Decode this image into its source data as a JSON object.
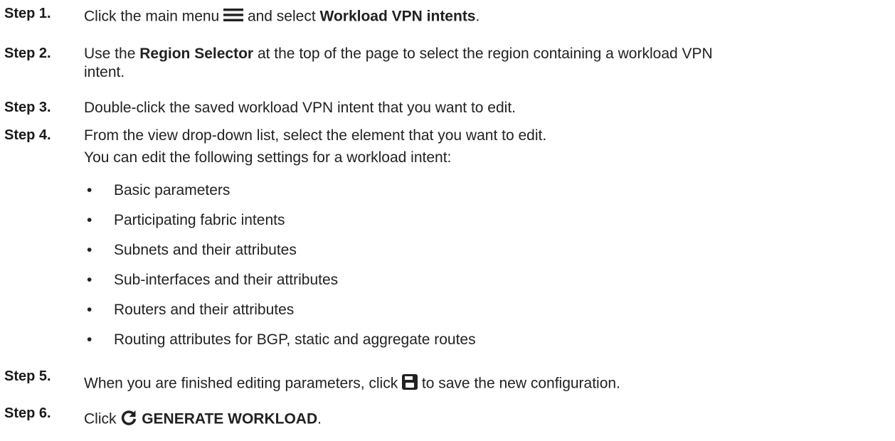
{
  "steps": [
    {
      "label": "Step 1.",
      "pre": "Click the main menu",
      "mid": "and select",
      "bold": "Workload VPN intents",
      "post": ".",
      "icon": "menu-icon"
    },
    {
      "label": "Step 2.",
      "pre": "Use the",
      "bold": "Region Selector",
      "post": "at the top of the page to select the region containing a workload VPN",
      "cont": "intent."
    },
    {
      "label": "Step 3.",
      "text": "Double-click the saved workload VPN intent that you want to edit."
    },
    {
      "label": "Step 4.",
      "text": "From the view drop-down list, select the element that you want to edit.",
      "subtext": "You can edit the following settings for a workload intent:",
      "bullet_char": "•",
      "bullets": [
        "Basic parameters",
        "Participating fabric intents",
        "Subnets and their attributes",
        "Sub-interfaces and their attributes",
        "Routers and their attributes",
        "Routing attributes for BGP, static and aggregate routes"
      ]
    },
    {
      "label": "Step 5.",
      "pre": "When you are finished editing parameters, click",
      "post": "to save the new configuration.",
      "icon": "save-icon"
    },
    {
      "label": "Step 6.",
      "pre": "Click",
      "bold": "GENERATE WORKLOAD",
      "post": ".",
      "icon": "refresh-icon"
    }
  ]
}
